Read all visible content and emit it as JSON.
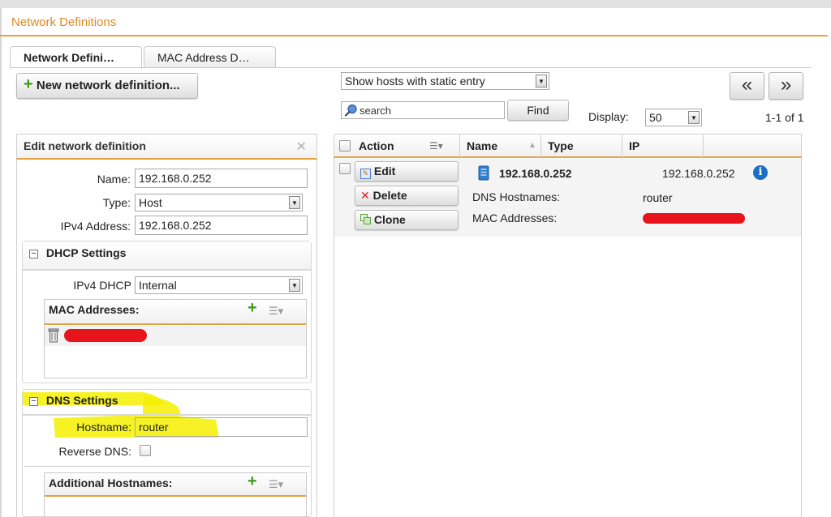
{
  "page": {
    "title": "Network Definitions"
  },
  "tabs": [
    {
      "label": "Network Defini…",
      "active": true
    },
    {
      "label": "MAC Address D…",
      "active": false
    }
  ],
  "toolbar": {
    "new_button": "New network definition..."
  },
  "filter": {
    "selected": "Show hosts with static entry",
    "search_placeholder": "search",
    "find_button": "Find",
    "display_label": "Display:",
    "display_value": "50",
    "paging": "1-1 of 1",
    "prev_symbol": "«",
    "next_symbol": "»"
  },
  "edit_panel": {
    "title": "Edit network definition",
    "close_symbol": "✕",
    "name_label": "Name:",
    "name_value": "192.168.0.252",
    "type_label": "Type:",
    "type_value": "Host",
    "ipv4_label": "IPv4 Address:",
    "ipv4_value": "192.168.0.252",
    "dhcp": {
      "title": "DHCP Settings",
      "ipv4_dhcp_label": "IPv4 DHCP",
      "ipv4_dhcp_value": "Internal",
      "mac_title": "MAC Addresses:"
    },
    "dns": {
      "title": "DNS Settings",
      "hostname_label": "Hostname:",
      "hostname_value": "router",
      "reverse_label": "Reverse DNS:",
      "additional_title": "Additional Hostnames:"
    }
  },
  "grid": {
    "headers": {
      "action": "Action",
      "name": "Name",
      "type": "Type",
      "ip": "IP"
    },
    "row": {
      "edit": "Edit",
      "delete": "Delete",
      "clone": "Clone",
      "name": "192.168.0.252",
      "ip": "192.168.0.252",
      "dns_label": "DNS Hostnames:",
      "dns_value": "router",
      "mac_label": "MAC Addresses:"
    }
  },
  "colors": {
    "accent": "#e8a13c",
    "title": "#e0891f",
    "highlight": "#f5f000",
    "redaction": "#e8141b",
    "info": "#1a6fc4"
  }
}
